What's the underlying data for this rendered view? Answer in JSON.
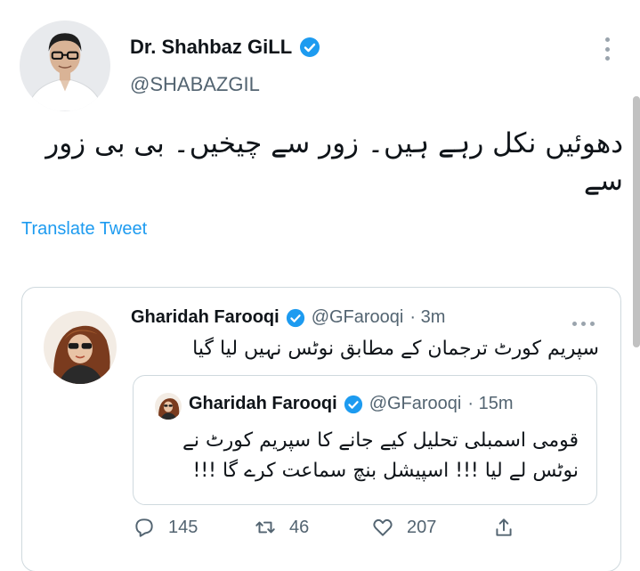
{
  "tweet": {
    "author": {
      "display_name": "Dr. Shahbaz GiLL",
      "handle": "@SHABAZGIL",
      "verified": true
    },
    "text": "دھوئیں نکل رہے ہیں۔ زور سے چیخیں۔ بی بی زور سے",
    "translate_label": "Translate Tweet",
    "more_icon": "more-vertical-icon"
  },
  "quoted_tweet": {
    "author": {
      "display_name": "Gharidah Farooqi",
      "handle": "@GFarooqi",
      "timestamp": "· 3m",
      "verified": true
    },
    "text": "سپریم کورٹ ترجمان کے مطابق نوٹس نہیں لیا گیا",
    "more_icon": "more-horizontal-icon",
    "nested_quote": {
      "author": {
        "display_name": "Gharidah Farooqi",
        "handle": "@GFarooqi",
        "timestamp": "· 15m",
        "verified": true
      },
      "text": "قومی اسمبلی تحلیل کیے جانے کا سپریم کورٹ نے نوٹس لے لیا !!! اسپیشل بنچ سماعت کرے گا !!!"
    },
    "actions": {
      "reply_count": "145",
      "retweet_count": "46",
      "like_count": "207"
    }
  },
  "colors": {
    "accent": "#1d9bf0",
    "text": "#0f1419",
    "secondary_text": "#536471",
    "border": "#cfd9de"
  }
}
